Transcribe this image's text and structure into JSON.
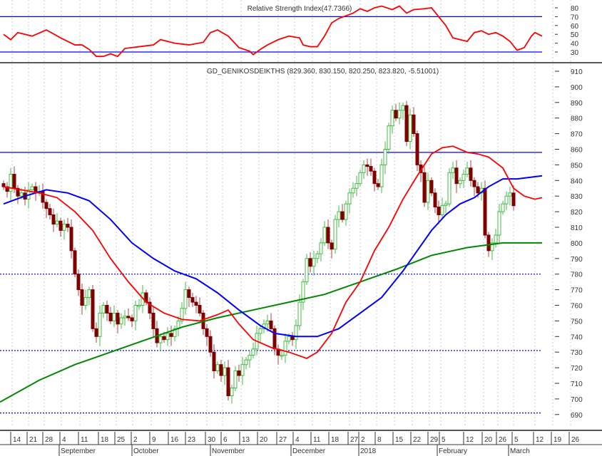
{
  "chart_data": {
    "type": "candlestick",
    "title": "GD_GENIKOSDEIKTHS (829.360, 830.150, 820.250, 823.820, -5.51001)",
    "rsi_title": "Relative Strength Index(47.7366)",
    "colors": {
      "up": "#44bb44",
      "down": "#800000",
      "ma_short": "#ff0000",
      "ma_mid": "#0000ff",
      "ma_long": "#008800",
      "rsi": "#ff0000",
      "level": "#0000ff"
    },
    "price_axis": {
      "min": 685,
      "max": 915,
      "ticks": [
        910,
        900,
        890,
        880,
        870,
        860,
        850,
        840,
        830,
        820,
        810,
        800,
        790,
        780,
        770,
        760,
        750,
        740,
        730,
        720,
        710,
        700,
        690
      ]
    },
    "rsi_axis": {
      "ticks": [
        80,
        70,
        60,
        50,
        40,
        30
      ],
      "levels": [
        70,
        30
      ]
    },
    "price_levels": [
      {
        "value": 858,
        "style": "solid"
      },
      {
        "value": 780,
        "style": "dotted"
      },
      {
        "value": 731,
        "style": "dotted"
      },
      {
        "value": 691,
        "style": "dotted"
      }
    ],
    "closes": [
      836,
      833,
      844,
      835,
      830,
      832,
      828,
      834,
      836,
      832,
      833,
      826,
      822,
      818,
      812,
      814,
      808,
      812,
      810,
      795,
      780,
      770,
      760,
      765,
      770,
      745,
      740,
      755,
      760,
      755,
      750,
      755,
      748,
      752,
      753,
      752,
      750,
      760,
      760,
      768,
      762,
      755,
      745,
      736,
      740,
      738,
      742,
      740,
      745,
      750,
      758,
      770,
      765,
      762,
      760,
      755,
      745,
      740,
      730,
      718,
      722,
      715,
      720,
      702,
      707,
      718,
      715,
      722,
      725,
      728,
      732,
      742,
      745,
      748,
      750,
      745,
      732,
      728,
      728,
      737,
      740,
      738,
      747,
      762,
      775,
      790,
      785,
      790,
      793,
      800,
      810,
      800,
      796,
      815,
      820,
      815,
      825,
      832,
      835,
      838,
      845,
      850,
      849,
      846,
      838,
      836,
      850,
      860,
      875,
      885,
      880,
      885,
      888,
      865,
      882,
      870,
      850,
      845,
      826,
      840,
      832,
      823,
      818,
      824,
      825,
      845,
      848,
      838,
      840,
      844,
      848,
      840,
      836,
      832,
      835,
      805,
      795,
      800,
      805,
      820,
      825,
      830,
      832,
      823.82
    ],
    "ma_short": [
      [
        0,
        836
      ],
      [
        10,
        832
      ],
      [
        15,
        829
      ],
      [
        20,
        820
      ],
      [
        25,
        808
      ],
      [
        30,
        790
      ],
      [
        35,
        775
      ],
      [
        40,
        762
      ],
      [
        45,
        755
      ],
      [
        50,
        751
      ],
      [
        55,
        750
      ],
      [
        60,
        754
      ],
      [
        63,
        757
      ],
      [
        66,
        748
      ],
      [
        70,
        738
      ],
      [
        75,
        733
      ],
      [
        80,
        730
      ],
      [
        85,
        726
      ],
      [
        88,
        730
      ],
      [
        92,
        742
      ],
      [
        96,
        762
      ],
      [
        100,
        775
      ],
      [
        104,
        795
      ],
      [
        108,
        810
      ],
      [
        112,
        828
      ],
      [
        116,
        843
      ],
      [
        120,
        857
      ],
      [
        123,
        861
      ],
      [
        126,
        862
      ],
      [
        130,
        858
      ],
      [
        133,
        857
      ],
      [
        136,
        855
      ],
      [
        140,
        848
      ],
      [
        143,
        835
      ],
      [
        146,
        830
      ],
      [
        149,
        828
      ],
      [
        151,
        829
      ]
    ],
    "ma_mid": [
      [
        0,
        825
      ],
      [
        6,
        830
      ],
      [
        12,
        834
      ],
      [
        18,
        832
      ],
      [
        24,
        827
      ],
      [
        30,
        815
      ],
      [
        36,
        800
      ],
      [
        42,
        790
      ],
      [
        48,
        782
      ],
      [
        54,
        777
      ],
      [
        60,
        768
      ],
      [
        66,
        757
      ],
      [
        72,
        747
      ],
      [
        76,
        742
      ],
      [
        82,
        740
      ],
      [
        88,
        740
      ],
      [
        94,
        745
      ],
      [
        100,
        755
      ],
      [
        106,
        765
      ],
      [
        112,
        782
      ],
      [
        116,
        795
      ],
      [
        120,
        808
      ],
      [
        124,
        818
      ],
      [
        128,
        825
      ],
      [
        132,
        829
      ],
      [
        136,
        836
      ],
      [
        140,
        841
      ],
      [
        144,
        841
      ],
      [
        151,
        843
      ]
    ],
    "ma_long": [
      [
        -1,
        698
      ],
      [
        10,
        712
      ],
      [
        20,
        722
      ],
      [
        30,
        730
      ],
      [
        40,
        738
      ],
      [
        50,
        746
      ],
      [
        60,
        752
      ],
      [
        70,
        757
      ],
      [
        80,
        762
      ],
      [
        90,
        767
      ],
      [
        100,
        775
      ],
      [
        110,
        783
      ],
      [
        120,
        792
      ],
      [
        130,
        797
      ],
      [
        140,
        800
      ],
      [
        151,
        800
      ]
    ],
    "rsi": [
      [
        0,
        50
      ],
      [
        2,
        44
      ],
      [
        4,
        52
      ],
      [
        8,
        48
      ],
      [
        12,
        55
      ],
      [
        16,
        46
      ],
      [
        20,
        38
      ],
      [
        22,
        38
      ],
      [
        24,
        33
      ],
      [
        26,
        25
      ],
      [
        28,
        25
      ],
      [
        30,
        28
      ],
      [
        32,
        25
      ],
      [
        34,
        34
      ],
      [
        38,
        36
      ],
      [
        42,
        38
      ],
      [
        44,
        44
      ],
      [
        48,
        40
      ],
      [
        52,
        38
      ],
      [
        56,
        41
      ],
      [
        58,
        52
      ],
      [
        60,
        55
      ],
      [
        63,
        48
      ],
      [
        66,
        35
      ],
      [
        69,
        31
      ],
      [
        70,
        27
      ],
      [
        72,
        33
      ],
      [
        74,
        38
      ],
      [
        77,
        44
      ],
      [
        80,
        48
      ],
      [
        83,
        46
      ],
      [
        84,
        38
      ],
      [
        86,
        36
      ],
      [
        88,
        36
      ],
      [
        90,
        48
      ],
      [
        92,
        63
      ],
      [
        94,
        68
      ],
      [
        96,
        71
      ],
      [
        98,
        74
      ],
      [
        100,
        79
      ],
      [
        102,
        76
      ],
      [
        104,
        80
      ],
      [
        106,
        82
      ],
      [
        109,
        78
      ],
      [
        111,
        82
      ],
      [
        113,
        74
      ],
      [
        115,
        78
      ],
      [
        118,
        79
      ],
      [
        120,
        80
      ],
      [
        122,
        70
      ],
      [
        124,
        60
      ],
      [
        126,
        46
      ],
      [
        128,
        44
      ],
      [
        130,
        42
      ],
      [
        132,
        52
      ],
      [
        134,
        54
      ],
      [
        136,
        50
      ],
      [
        138,
        52
      ],
      [
        140,
        48
      ],
      [
        142,
        42
      ],
      [
        144,
        32
      ],
      [
        146,
        35
      ],
      [
        148,
        48
      ],
      [
        149,
        52
      ],
      [
        151,
        48
      ]
    ],
    "x_ticks": [
      {
        "label": "14",
        "i": 2.4
      },
      {
        "label": "21",
        "i": 7
      },
      {
        "label": "28",
        "i": 11.4
      },
      {
        "label": "4",
        "i": 16.2
      },
      {
        "label": "11",
        "i": 21.4
      },
      {
        "label": "18",
        "i": 27
      },
      {
        "label": "25",
        "i": 31.6
      },
      {
        "label": "2",
        "i": 36.2
      },
      {
        "label": "9",
        "i": 41.4
      },
      {
        "label": "16",
        "i": 46.6
      },
      {
        "label": "23",
        "i": 51.4
      },
      {
        "label": "30",
        "i": 57
      },
      {
        "label": "6",
        "i": 61.4
      },
      {
        "label": "13",
        "i": 66.6
      },
      {
        "label": "20",
        "i": 71.6
      },
      {
        "label": "27",
        "i": 77
      },
      {
        "label": "4",
        "i": 81.6
      },
      {
        "label": "11",
        "i": 86.6
      },
      {
        "label": "18",
        "i": 91.6
      },
      {
        "label": "27",
        "i": 97
      },
      {
        "label": "2",
        "i": 100
      },
      {
        "label": "8",
        "i": 104.6
      },
      {
        "label": "15",
        "i": 109.6
      },
      {
        "label": "22",
        "i": 114.6
      },
      {
        "label": "29",
        "i": 119.4
      },
      {
        "label": "5",
        "i": 122.6
      },
      {
        "label": "12",
        "i": 129.4
      },
      {
        "label": "20",
        "i": 134.6
      },
      {
        "label": "26",
        "i": 138.6
      },
      {
        "label": "5",
        "i": 143
      },
      {
        "label": "12",
        "i": 149
      },
      {
        "label": "19",
        "i": 154
      },
      {
        "label": "26",
        "i": 159
      }
    ],
    "months": [
      {
        "label": "September",
        "i": 15.6
      },
      {
        "label": "October",
        "i": 36
      },
      {
        "label": "November",
        "i": 58
      },
      {
        "label": "December",
        "i": 80.6
      },
      {
        "label": "2018",
        "i": 99.6
      },
      {
        "label": "February",
        "i": 121.6
      },
      {
        "label": "March",
        "i": 141.6
      }
    ]
  }
}
